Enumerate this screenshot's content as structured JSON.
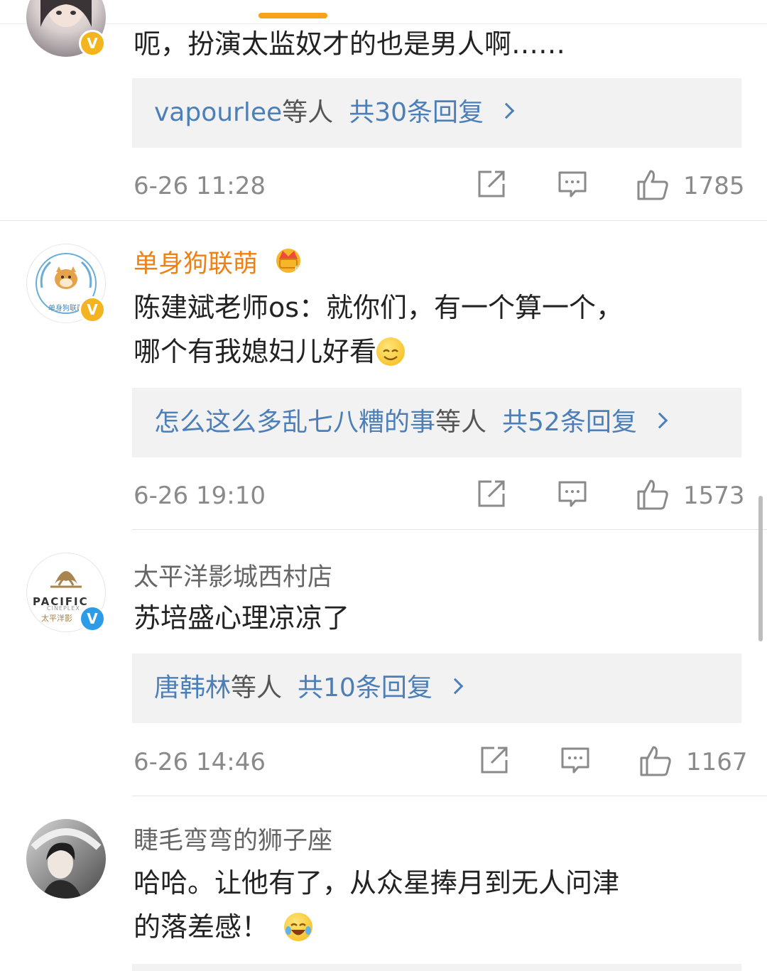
{
  "comments": [
    {
      "username": "",
      "badge": "gold",
      "text": [
        "呃，扮演太监奴才的也是男人啊……"
      ],
      "reply_users": "vapourlee",
      "reply_suffix": "等人",
      "reply_count": "共30条回复",
      "time": "6-26 11:28",
      "likes": "1785"
    },
    {
      "username": "单身狗联萌",
      "badge": "gold",
      "avatar_text": "单身狗联萌",
      "text": [
        "陈建斌老师os：就你们，有一个算一个，",
        "哪个有我媳妇儿好看"
      ],
      "reply_users": "怎么这么多乱七八糟的事",
      "reply_suffix": "等人",
      "reply_count": "共52条回复",
      "time": "6-26 19:10",
      "likes": "1573"
    },
    {
      "username": "太平洋影城西村店",
      "badge": "blue",
      "avatar_text": "PACIFIC",
      "avatar_sub": "CINEPLEX",
      "avatar_cn": "太平洋影",
      "text": [
        "苏培盛心理凉凉了"
      ],
      "reply_users": "唐韩林",
      "reply_suffix": "等人",
      "reply_count": "共10条回复",
      "time": "6-26 14:46",
      "likes": "1167"
    },
    {
      "username": "睫毛弯弯的狮子座",
      "badge": "none",
      "text": [
        "哈哈。让他有了，从众星捧月到无人问津",
        "的落差感！"
      ]
    }
  ],
  "colors": {
    "accent": "#f7a21b",
    "vip_name": "#f08013",
    "link": "#4c7fb8",
    "verified_gold": "#f3b41f",
    "verified_blue": "#2d9be8"
  },
  "icons": [
    "share-icon",
    "comment-icon",
    "like-icon",
    "verified-badge-icon",
    "vip-crown-icon",
    "smile-emoji-icon",
    "laugh-cry-emoji-icon"
  ]
}
